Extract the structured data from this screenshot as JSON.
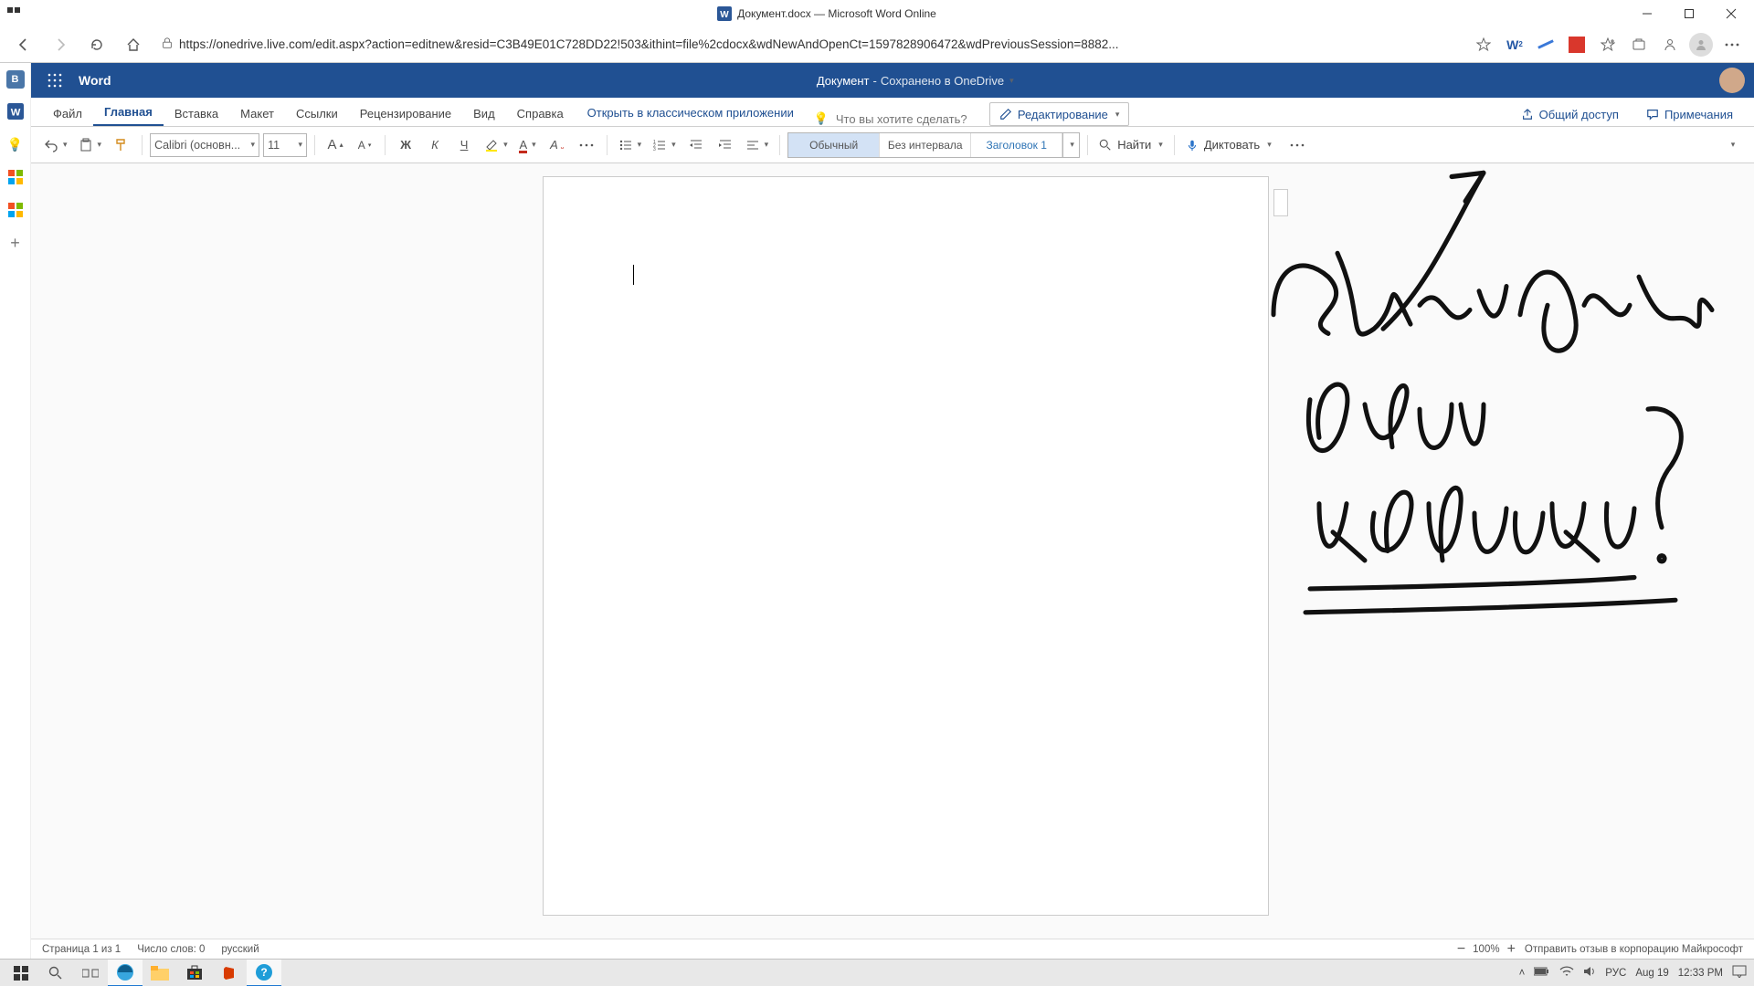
{
  "window": {
    "title": "Документ.docx — Microsoft Word Online"
  },
  "browser": {
    "url": "https://onedrive.live.com/edit.aspx?action=editnew&resid=C3B49E01C728DD22!503&ithint=file%2cdocx&wdNewAndOpenCt=1597828906472&wdPreviousSession=8882..."
  },
  "app": {
    "brand": "Word",
    "doc_name": "Документ",
    "save_state": "Сохранено в OneDrive",
    "sep": " - "
  },
  "ribbon": {
    "tabs": [
      "Файл",
      "Главная",
      "Вставка",
      "Макет",
      "Ссылки",
      "Рецензирование",
      "Вид",
      "Справка"
    ],
    "active_index": 1,
    "open_desktop": "Открыть в классическом приложении",
    "tell_me_placeholder": "Что вы хотите сделать?",
    "editing_label": "Редактирование",
    "share_label": "Общий доступ",
    "comments_label": "Примечания"
  },
  "toolbar": {
    "font_name": "Calibri (основн...",
    "font_size": "11",
    "styles": [
      "Обычный",
      "Без интервала",
      "Заголовок 1"
    ],
    "find_label": "Найти",
    "dictate_label": "Диктовать"
  },
  "status": {
    "page": "Страница 1 из 1",
    "words": "Число слов: 0",
    "lang": "русский",
    "zoom": "100%",
    "feedback": "Отправить отзыв в корпорацию Майкрософт"
  },
  "taskbar": {
    "lang": "РУС",
    "date": "Aug 19",
    "time": "12:33 PM"
  }
}
